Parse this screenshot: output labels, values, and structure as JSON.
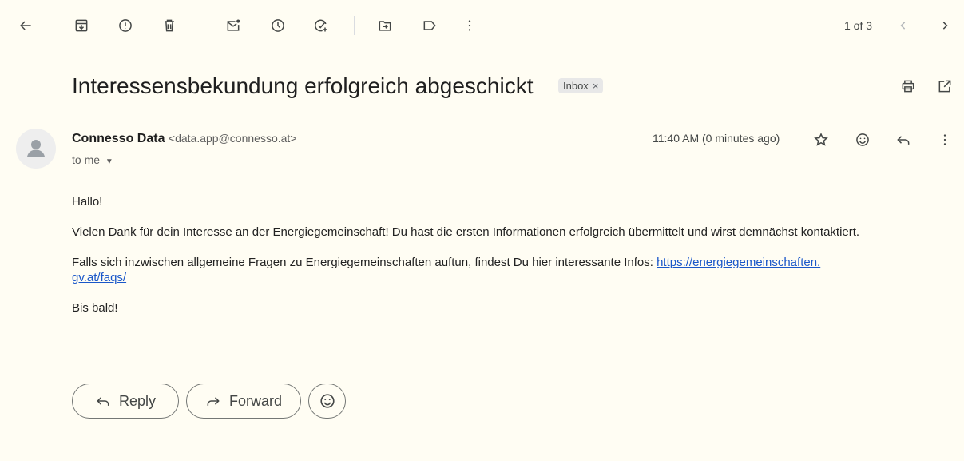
{
  "toolbar": {
    "icons": [
      "back-arrow-icon",
      "archive-icon",
      "report-spam-icon",
      "delete-icon",
      "mark-unread-icon",
      "snooze-icon",
      "add-to-tasks-icon",
      "move-to-icon",
      "labels-icon",
      "more-vert-icon"
    ],
    "pager_text": "1 of 3"
  },
  "message": {
    "subject": "Interessensbekundung erfolgreich abgeschickt",
    "label": "Inbox",
    "label_remove": "×",
    "sender_name": "Connesso Data",
    "sender_email": "<data.app@connesso.at>",
    "to_text": "to me",
    "timestamp": "11:40 AM (0 minutes ago)",
    "body": {
      "greeting": "Hallo!",
      "p1": "Vielen Dank für dein Interesse an der Energiegemeinschaft! Du hast die ersten Informationen erfolgreich übermittelt und wirst demnächst kontaktiert.",
      "p2_prefix": "Falls sich inzwischen allgemeine Fragen zu Energiegemeinschaften auftun, findest Du hier interessante Infos: ",
      "p2_link_line1": "https://energiegemeinschaften.",
      "p2_link_line2": "gv.at/faqs/",
      "closing": "Bis bald!"
    }
  },
  "actions": {
    "reply_label": "Reply",
    "forward_label": "Forward"
  }
}
